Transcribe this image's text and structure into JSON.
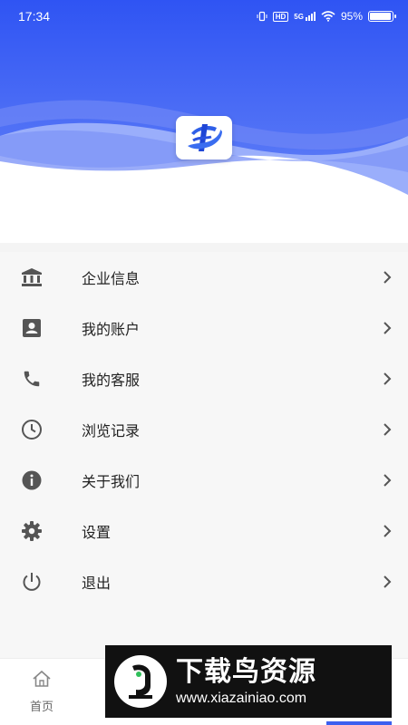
{
  "status_bar": {
    "time": "17:34",
    "network": "5G",
    "hd": "HD",
    "battery_text": "95%",
    "battery_level": 0.95
  },
  "colors": {
    "header_top": "#3a5cf5",
    "header_wave_light": "#8fa4fb",
    "icon_gray": "#555555",
    "accent": "#3b5ff0"
  },
  "menu": {
    "items": [
      {
        "label": "企业信息",
        "icon": "bank-icon"
      },
      {
        "label": "我的账户",
        "icon": "account-icon"
      },
      {
        "label": "我的客服",
        "icon": "phone-icon"
      },
      {
        "label": "浏览记录",
        "icon": "clock-icon"
      },
      {
        "label": "关于我们",
        "icon": "info-icon"
      },
      {
        "label": "设置",
        "icon": "gear-icon"
      },
      {
        "label": "退出",
        "icon": "power-icon"
      }
    ]
  },
  "bottom_nav": {
    "home_label": "首页"
  },
  "watermark": {
    "title": "下载鸟资源",
    "url": "www.xiazainiao.com"
  }
}
